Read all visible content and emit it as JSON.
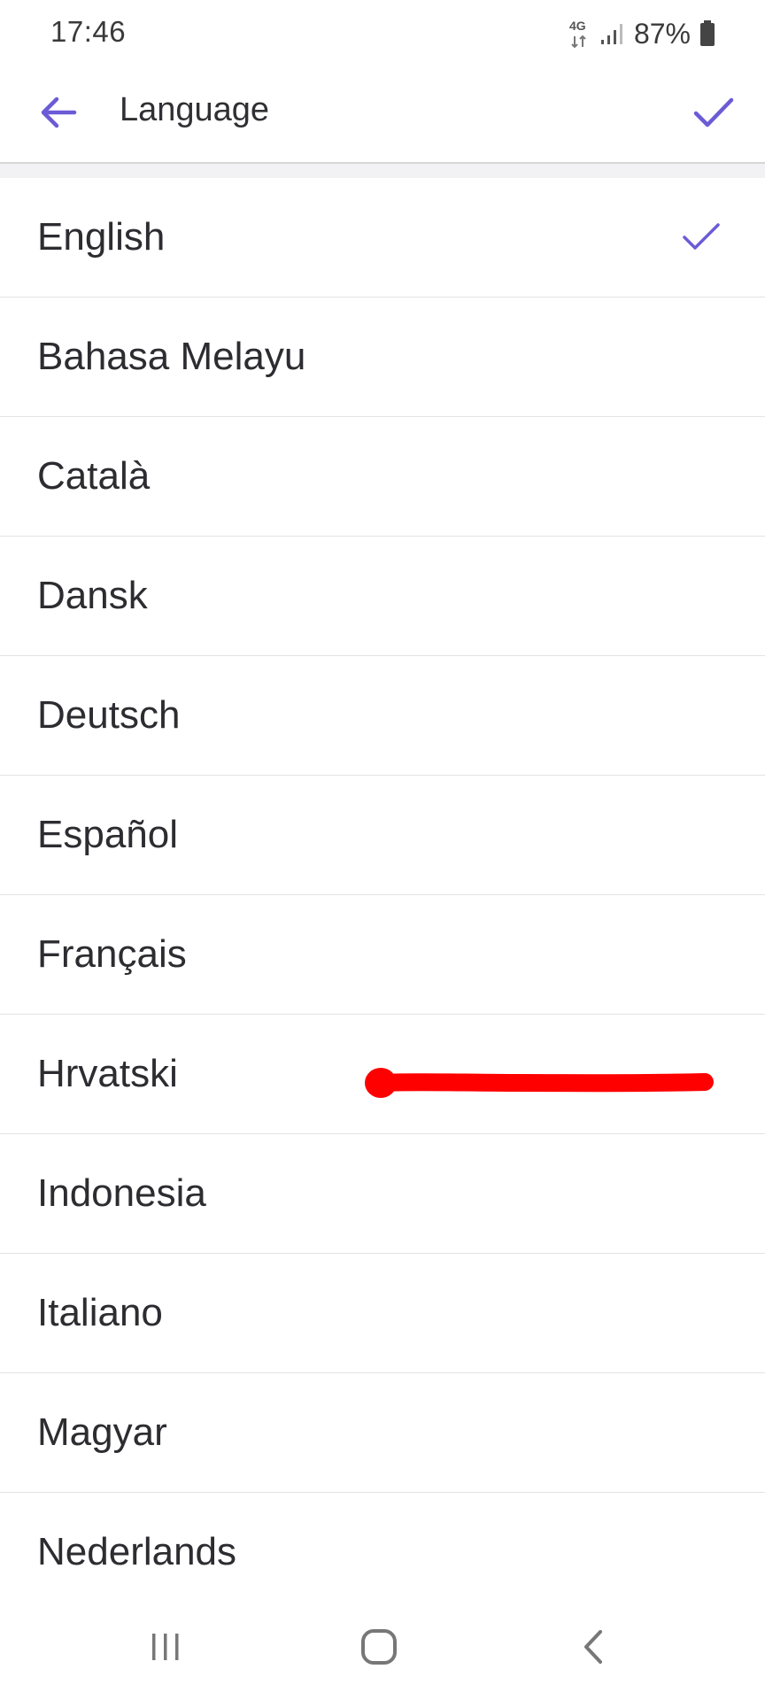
{
  "status_bar": {
    "time": "17:46",
    "network": "4G",
    "battery_percent": "87%"
  },
  "header": {
    "title": "Language",
    "back_icon": "arrow-left-icon",
    "confirm_icon": "check-icon"
  },
  "accent_color": "#6b5bd6",
  "annotation_color": "#ff0000",
  "languages": [
    {
      "label": "English",
      "selected": true
    },
    {
      "label": "Bahasa Melayu",
      "selected": false
    },
    {
      "label": "Català",
      "selected": false
    },
    {
      "label": "Dansk",
      "selected": false
    },
    {
      "label": "Deutsch",
      "selected": false
    },
    {
      "label": "Español",
      "selected": false
    },
    {
      "label": "Français",
      "selected": false
    },
    {
      "label": "Hrvatski",
      "selected": false
    },
    {
      "label": "Indonesia",
      "selected": false
    },
    {
      "label": "Italiano",
      "selected": false
    },
    {
      "label": "Magyar",
      "selected": false
    },
    {
      "label": "Nederlands",
      "selected": false
    }
  ],
  "nav_bar": {
    "recents_icon": "recents-icon",
    "home_icon": "home-icon",
    "back_icon": "back-chevron-icon"
  }
}
